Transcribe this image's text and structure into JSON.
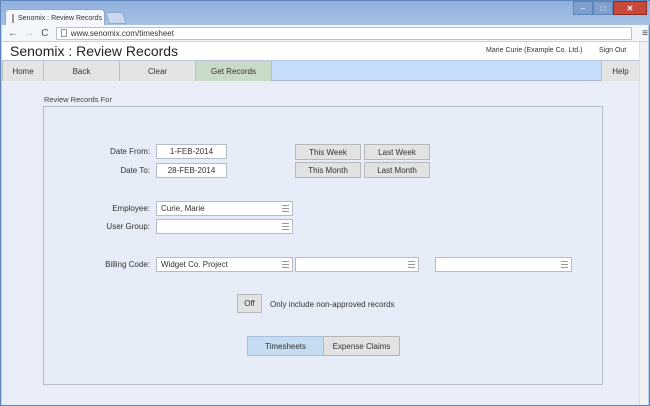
{
  "browser": {
    "tab_title": "Senomix : Review Records",
    "tab_close": "×",
    "url": "www.senomix.com/timesheet"
  },
  "header": {
    "app_title": "Senomix : Review Records",
    "user": "Marie Curie  (Example Co. Ltd.)",
    "sign_out": "Sign Out"
  },
  "menubar": {
    "home": "Home",
    "back": "Back",
    "clear": "Clear",
    "get_records": "Get Records",
    "help": "Help"
  },
  "form": {
    "section_label": "Review Records For",
    "date_from_label": "Date From:",
    "date_from": "1-FEB-2014",
    "date_to_label": "Date To:",
    "date_to": "28-FEB-2014",
    "this_week": "This Week",
    "last_week": "Last Week",
    "this_month": "This Month",
    "last_month": "Last Month",
    "employee_label": "Employee:",
    "employee": "Curie, Marie",
    "user_group_label": "User Group:",
    "user_group": "",
    "billing_code_label": "Billing Code:",
    "billing_code_1": "Widget Co. Project",
    "billing_code_2": "",
    "billing_code_3": "",
    "toggle_label": "Off",
    "toggle_text": "Only include non-approved records",
    "timesheets": "Timesheets",
    "expense_claims": "Expense Claims"
  },
  "colors": {
    "menubar_bg": "#c6dcfb",
    "get_records_bg": "#c8dbc6",
    "timesheets_bg": "#c6dcf2",
    "page_bg": "#e8edf7"
  }
}
